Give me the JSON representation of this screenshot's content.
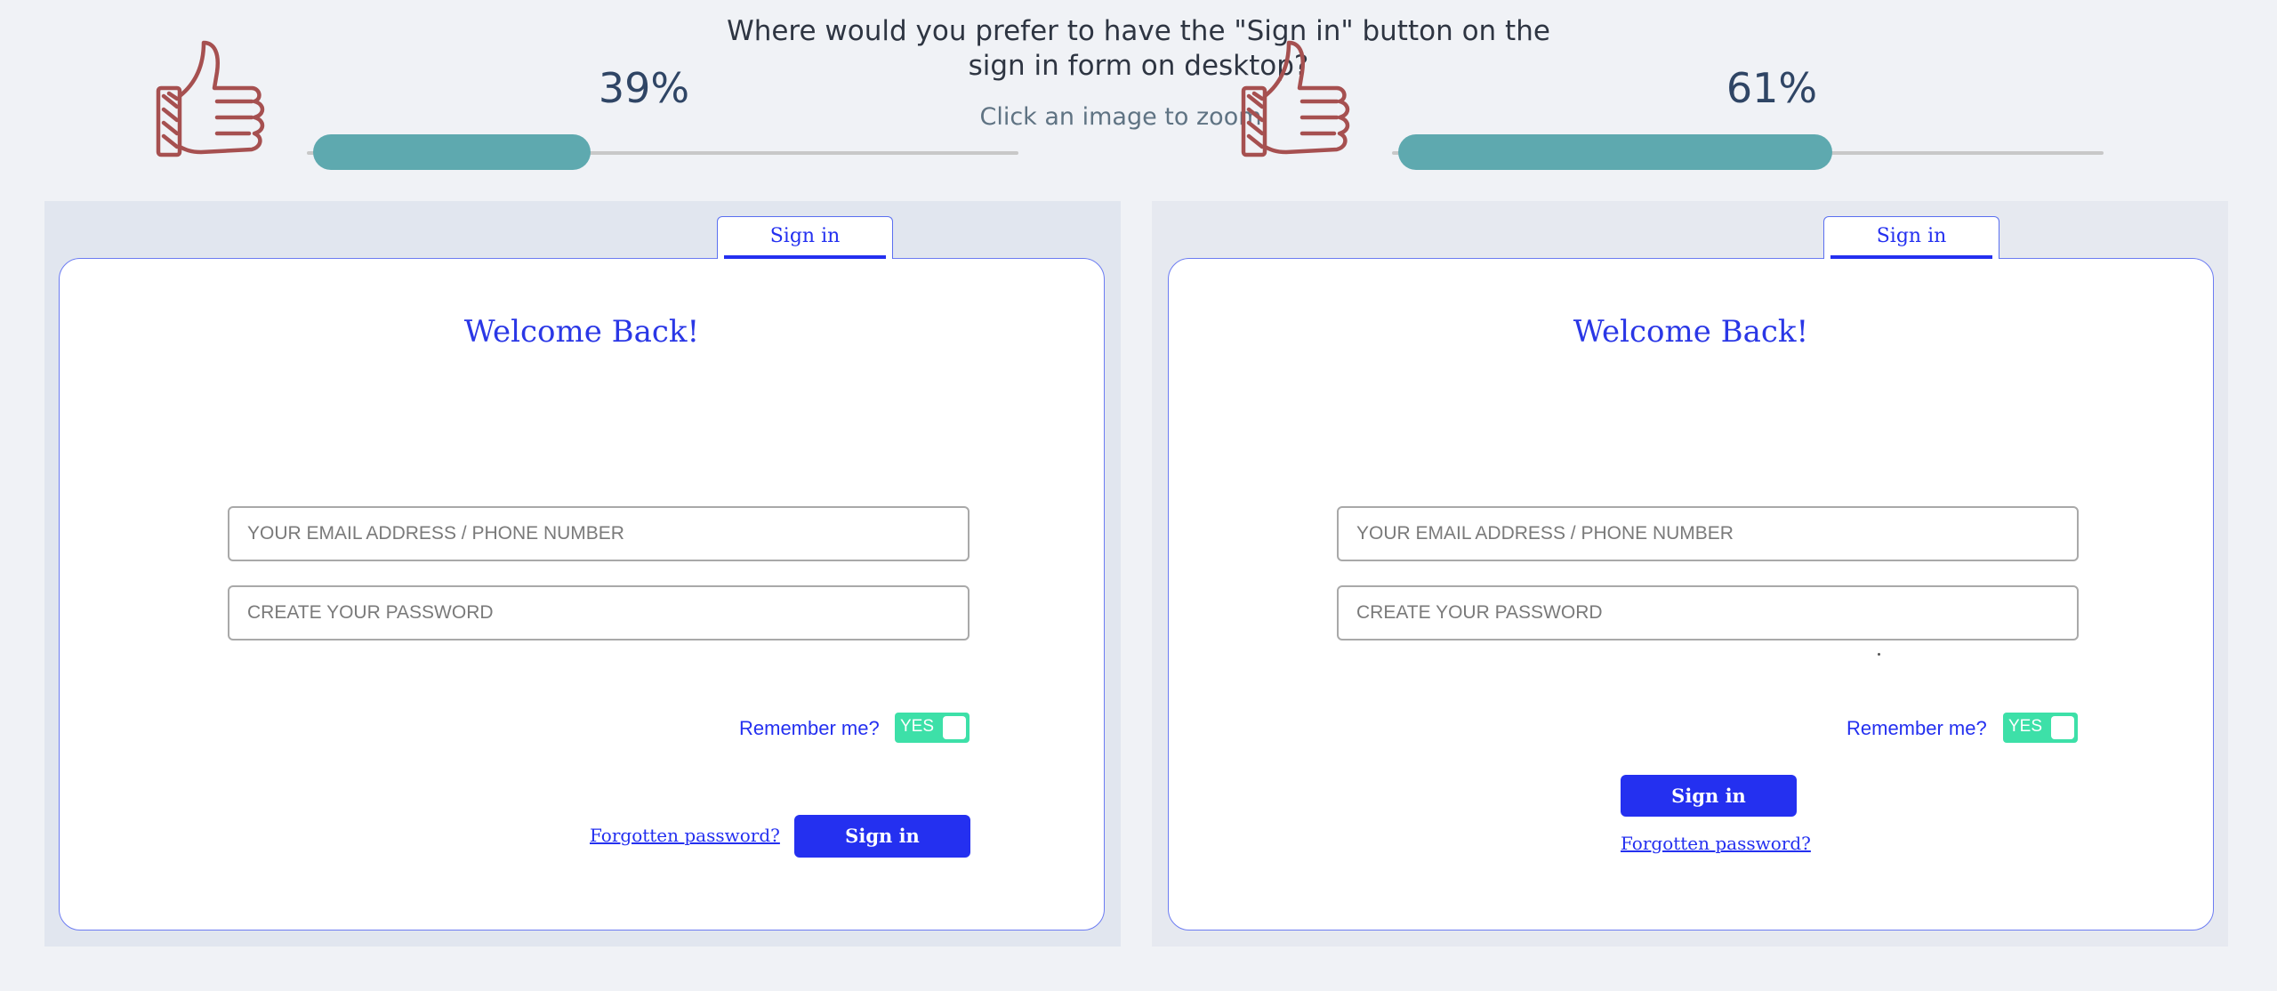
{
  "survey": {
    "question": "Where would you prefer to have the \"Sign in\" button on the sign in form on desktop?",
    "subtitle": "Click an image to zoom"
  },
  "results": [
    {
      "percent_label": "39%",
      "value": 0.39
    },
    {
      "percent_label": "61%",
      "value": 0.61
    }
  ],
  "colors": {
    "accent": "#2430f0",
    "bar_fill": "#5ea9af",
    "toggle": "#3de0a8",
    "thumb": "#a65050"
  },
  "variants": [
    {
      "tab_label": "Sign in",
      "welcome": "Welcome Back!",
      "email_placeholder": "YOUR EMAIL ADDRESS / PHONE NUMBER",
      "password_placeholder": "CREATE YOUR PASSWORD",
      "remember_label": "Remember me?",
      "toggle_label": "YES",
      "forgot_label": "Forgotten password?",
      "signin_button": "Sign in"
    },
    {
      "tab_label": "Sign in",
      "welcome": "Welcome Back!",
      "email_placeholder": "YOUR EMAIL ADDRESS / PHONE NUMBER",
      "password_placeholder": "CREATE YOUR PASSWORD",
      "remember_label": "Remember me?",
      "toggle_label": "YES",
      "forgot_label": "Forgotten password?",
      "signin_button": "Sign in"
    }
  ],
  "icons": {
    "vote": "thumbs-up-icon"
  }
}
